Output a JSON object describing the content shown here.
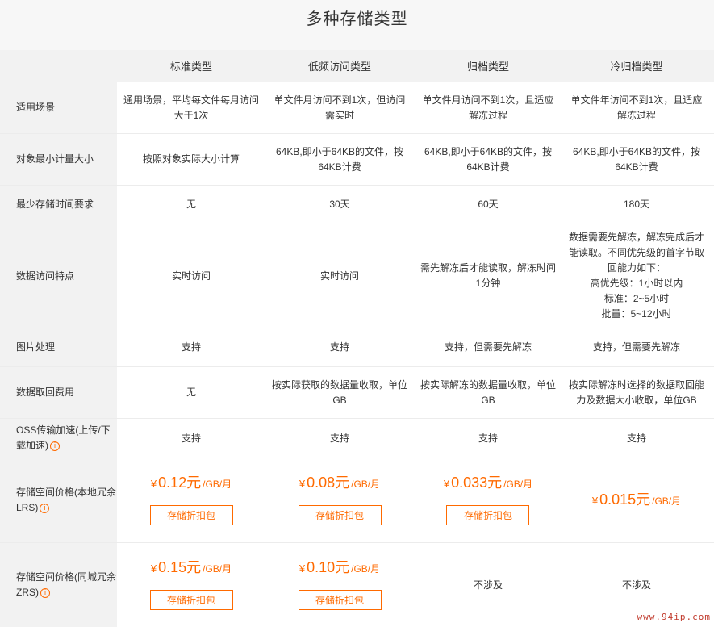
{
  "title": "多种存储类型",
  "columns": [
    "标准类型",
    "低频访问类型",
    "归档类型",
    "冷归档类型"
  ],
  "rows": {
    "scene": {
      "label": "适用场景",
      "values": [
        "通用场景，平均每文件每月访问大于1次",
        "单文件月访问不到1次，但访问需实时",
        "单文件月访问不到1次，且适应解冻过程",
        "单文件年访问不到1次，且适应解冻过程"
      ]
    },
    "min_size": {
      "label": "对象最小计量大小",
      "values": [
        "按照对象实际大小计算",
        "64KB,即小于64KB的文件，按64KB计费",
        "64KB,即小于64KB的文件，按64KB计费",
        "64KB,即小于64KB的文件，按64KB计费"
      ]
    },
    "min_time": {
      "label": "最少存储时间要求",
      "values": [
        "无",
        "30天",
        "60天",
        "180天"
      ]
    },
    "access": {
      "label": "数据访问特点",
      "values": [
        "实时访问",
        "实时访问",
        "需先解冻后才能读取，解冻时间1分钟",
        "数据需要先解冻，解冻完成后才能读取。不同优先级的首字节取回能力如下：\n高优先级：1小时以内\n标准：2~5小时\n批量：5~12小时"
      ]
    },
    "image": {
      "label": "图片处理",
      "values": [
        "支持",
        "支持",
        "支持，但需要先解冻",
        "支持，但需要先解冻"
      ]
    },
    "retrieval": {
      "label": "数据取回费用",
      "values": [
        "无",
        "按实际获取的数据量收取，单位GB",
        "按实际解冻的数据量收取，单位GB",
        "按实际解冻时选择的数据取回能力及数据大小收取，单位GB"
      ]
    },
    "oss": {
      "label": "OSS传输加速(上传/下载加速)",
      "values": [
        "支持",
        "支持",
        "支持",
        "支持"
      ]
    },
    "lrs": {
      "label": "存储空间价格(本地冗余LRS)",
      "prices": [
        "0.12元",
        "0.08元",
        "0.033元",
        "0.015元"
      ]
    },
    "zrs": {
      "label": "存储空间价格(同城冗余ZRS)",
      "prices": [
        "0.15元",
        "0.10元"
      ],
      "na": [
        "不涉及",
        "不涉及"
      ]
    }
  },
  "currency": "¥",
  "price_unit": "/GB/月",
  "button_label": "存储折扣包",
  "info_icon": "i",
  "watermark": "www.94ip.com",
  "colors": {
    "accent": "#ff6a00",
    "header_bg": "#f2f2f2",
    "title_bg": "#f7f7f7"
  }
}
